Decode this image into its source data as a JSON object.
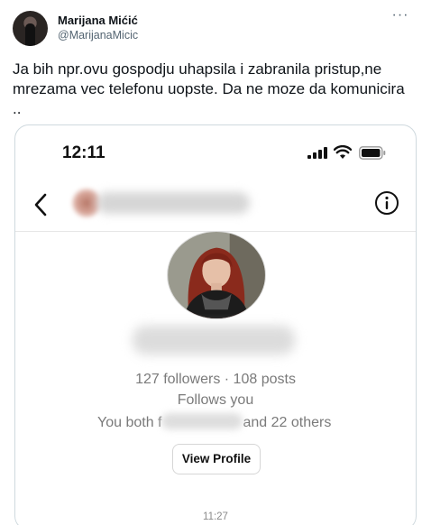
{
  "tweet": {
    "author_name": "Marijana Mićić",
    "author_handle": "@MarijanaMicic",
    "more_icon": "more-horizontal-icon",
    "text": "Ja bih npr.ovu gospodju uhapsila i zabranila pristup,ne mrezama vec telefonu uopste. Da ne moze da komunicira .."
  },
  "screenshot": {
    "status_bar": {
      "time": "12:11",
      "icons": [
        "signal-icon",
        "wifi-icon",
        "battery-icon"
      ]
    },
    "nav": {
      "back_icon": "chevron-left-icon",
      "info_icon": "info-icon"
    },
    "profile": {
      "stats": "127 followers · 108 posts",
      "follows_you": "Follows you",
      "mutuals_prefix": "You both f",
      "mutuals_suffix": "and 22 others",
      "view_profile_label": "View Profile"
    },
    "message_time": "11:27"
  },
  "colors": {
    "text_primary": "#0f1419",
    "text_secondary": "#536471",
    "border": "#cfd9de",
    "profile_text_gray": "#7a7a7a"
  }
}
